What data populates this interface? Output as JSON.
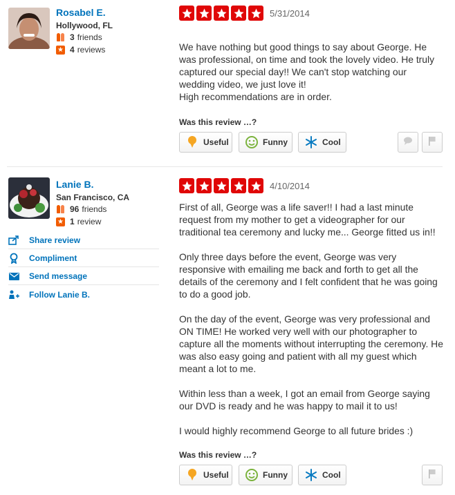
{
  "reviews": [
    {
      "user": {
        "name": "Rosabel E.",
        "location": "Hollywood, FL",
        "friends_count": "3",
        "friends_label": "friends",
        "reviews_count": "4",
        "reviews_label": "reviews"
      },
      "rating": 5,
      "date": "5/31/2014",
      "paragraphs": [
        "We have nothing but good things to say about George. He was professional, on time and took the lovely video. He truly captured our special day!! We can't stop watching our wedding video, we just love it!\nHigh recommendations are in order."
      ],
      "feedback": {
        "prompt": "Was this review …?",
        "useful": "Useful",
        "funny": "Funny",
        "cool": "Cool"
      }
    },
    {
      "user": {
        "name": "Lanie B.",
        "location": "San Francisco, CA",
        "friends_count": "96",
        "friends_label": "friends",
        "reviews_count": "1",
        "reviews_label": "review"
      },
      "rating": 5,
      "date": "4/10/2014",
      "paragraphs": [
        "First of all, George was a life saver!! I had a last minute request from my mother to get a videographer for our traditional tea ceremony and lucky me... George fitted us in!!",
        "Only three days before the event, George was very responsive with emailing me back and forth to get all the details of the ceremony and I felt confident that he was going to do a good job.",
        "On the day of the event, George was very professional and ON TIME! He worked very well with our photographer to capture all the moments without interrupting the ceremony. He was also easy going and patient with all my guest which meant a lot to me.",
        "Within less than a week, I got an email from George saying our DVD is ready and he was happy to mail it to us!",
        "I would highly recommend George to all future brides :)"
      ],
      "actions": {
        "share": "Share review",
        "compliment": "Compliment",
        "message": "Send message",
        "follow": "Follow Lanie B."
      },
      "feedback": {
        "prompt": "Was this review …?",
        "useful": "Useful",
        "funny": "Funny",
        "cool": "Cool"
      }
    }
  ],
  "colors": {
    "star_red": "#e00707",
    "link_blue": "#0073bb",
    "brand_orange": "#f15c00"
  },
  "icons": [
    "star-icon",
    "friends-icon",
    "reviews-icon",
    "lightbulb-icon",
    "smiley-icon",
    "snowflake-icon",
    "comment-icon",
    "flag-icon",
    "share-icon",
    "compliment-icon",
    "envelope-icon",
    "follow-icon"
  ]
}
